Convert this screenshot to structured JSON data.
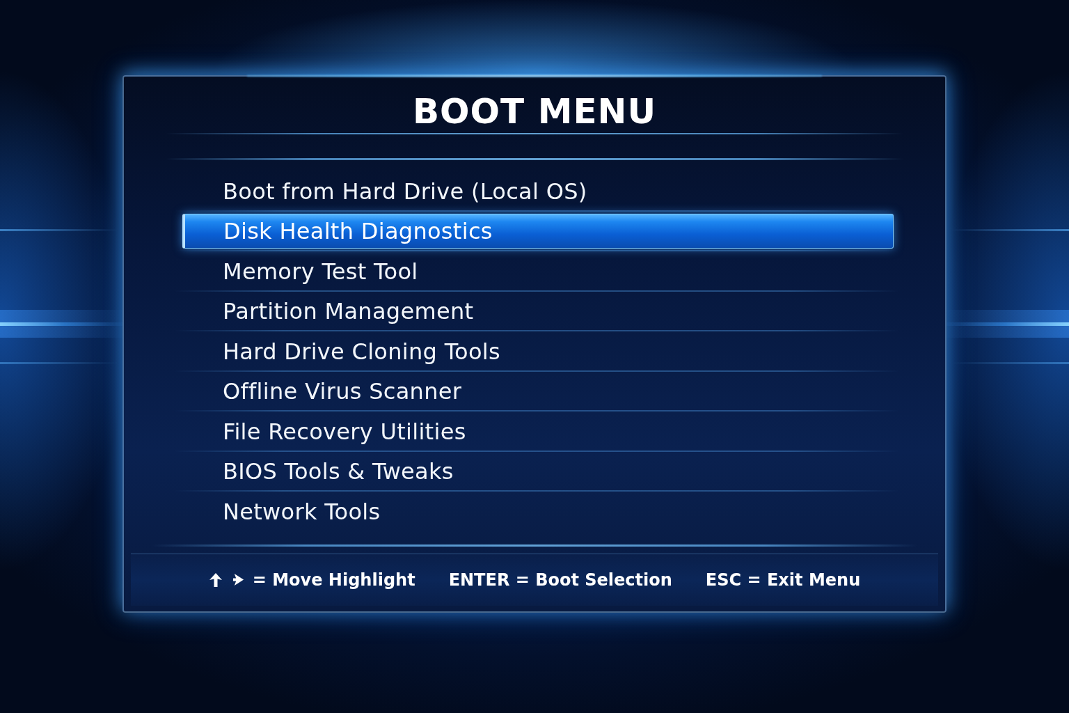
{
  "title": "BOOT MENU",
  "menu": {
    "items": [
      {
        "label": "Boot from Hard Drive (Local OS)",
        "selected": false
      },
      {
        "label": "Disk Health Diagnostics",
        "selected": true
      },
      {
        "label": "Memory Test Tool",
        "selected": false
      },
      {
        "label": "Partition Management",
        "selected": false
      },
      {
        "label": "Hard Drive Cloning Tools",
        "selected": false
      },
      {
        "label": "Offline Virus Scanner",
        "selected": false
      },
      {
        "label": "File Recovery Utilities",
        "selected": false
      },
      {
        "label": "BIOS Tools & Tweaks",
        "selected": false
      },
      {
        "label": "Network Tools",
        "selected": false
      }
    ]
  },
  "footer": {
    "hints": [
      {
        "kind": "arrows",
        "text": "= Move Highlight"
      },
      {
        "kind": "text",
        "text": "ENTER = Boot Selection"
      },
      {
        "kind": "text",
        "text": "ESC = Exit Menu"
      }
    ]
  }
}
